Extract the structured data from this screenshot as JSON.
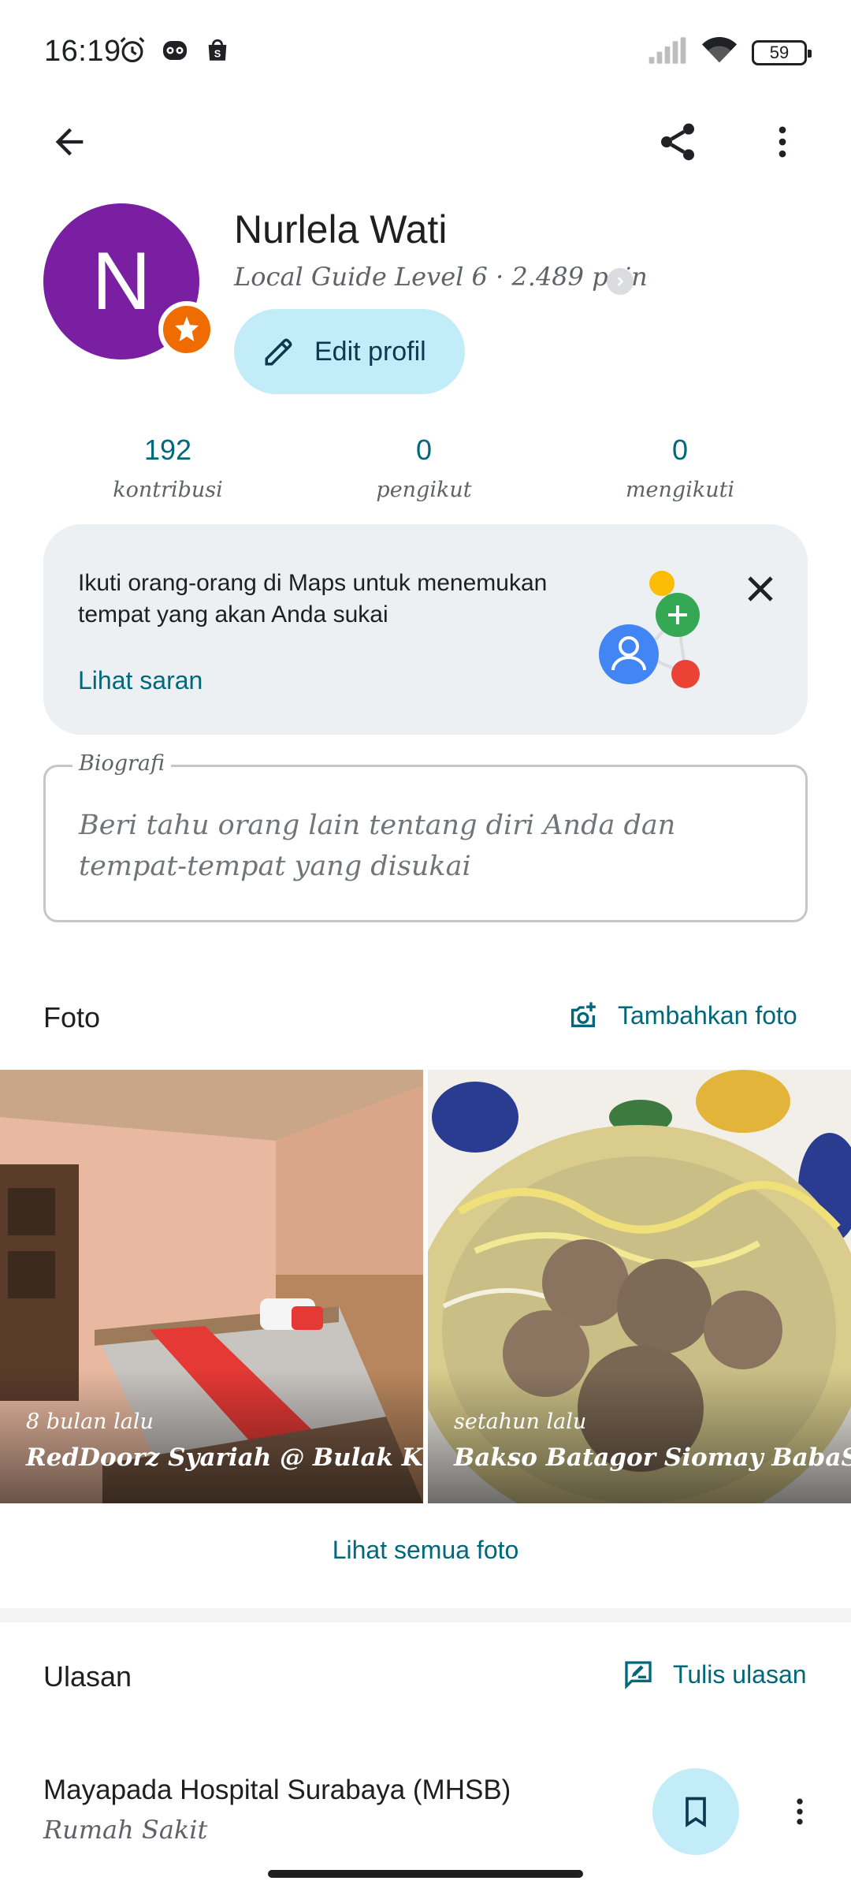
{
  "status_bar": {
    "time": "16:19",
    "battery": "59",
    "left_icons": [
      "alarm-icon",
      "owl-app-icon",
      "shopping-bag-icon"
    ],
    "right_icons": [
      "signal-icon",
      "wifi-icon",
      "battery-icon"
    ]
  },
  "appbar": {
    "icons": [
      "back-arrow-icon",
      "share-icon",
      "more-vert-icon"
    ]
  },
  "profile": {
    "initial": "N",
    "name": "Nurlela Wati",
    "level": "Local Guide Level 6 · 2.489 poin",
    "edit_label": "Edit profil",
    "avatar_color": "#7b1fa2",
    "badge_color": "#ef6c00"
  },
  "stats": [
    {
      "value": "192",
      "label": "kontribusi"
    },
    {
      "value": "0",
      "label": "pengikut"
    },
    {
      "value": "0",
      "label": "mengikuti"
    }
  ],
  "suggestion": {
    "text": "Ikuti orang-orang di Maps untuk menemukan tempat yang akan Anda sukai",
    "link": "Lihat saran"
  },
  "bio": {
    "legend": "Biografi",
    "placeholder": "Beri tahu orang lain tentang diri Anda dan tempat-tempat yang disukai"
  },
  "photos": {
    "title": "Foto",
    "add_label": "Tambahkan foto",
    "items": [
      {
        "time": "8 bulan lalu",
        "place": "RedDoorz Syariah @ Bulak Kapal"
      },
      {
        "time": "setahun lalu",
        "place": "Bakso Batagor Siomay BabaSyi'ra"
      }
    ],
    "see_all": "Lihat semua foto"
  },
  "reviews": {
    "title": "Ulasan",
    "write_label": "Tulis ulasan",
    "items": [
      {
        "name": "Mayapada Hospital Surabaya (MHSB)",
        "category": "Rumah Sakit"
      }
    ]
  },
  "colors": {
    "accent": "#00687a",
    "chip_bg": "#c2ecf8",
    "card_bg": "#ecf0f3"
  }
}
